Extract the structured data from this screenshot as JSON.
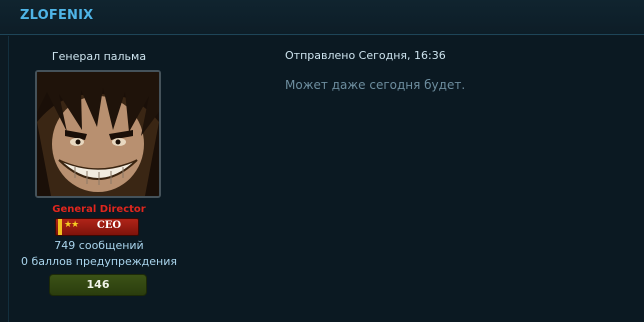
{
  "header": {
    "username": "ZLOFENIX"
  },
  "author": {
    "title": "Генерал пальма",
    "group": "General Director",
    "rank_label": "CEO",
    "post_count": "749 сообщений",
    "warning_points": "0 баллов предупреждения",
    "reputation": "146"
  },
  "post": {
    "meta": "Отправлено Сегодня, 16:36",
    "text": "Может даже сегодня будет."
  }
}
